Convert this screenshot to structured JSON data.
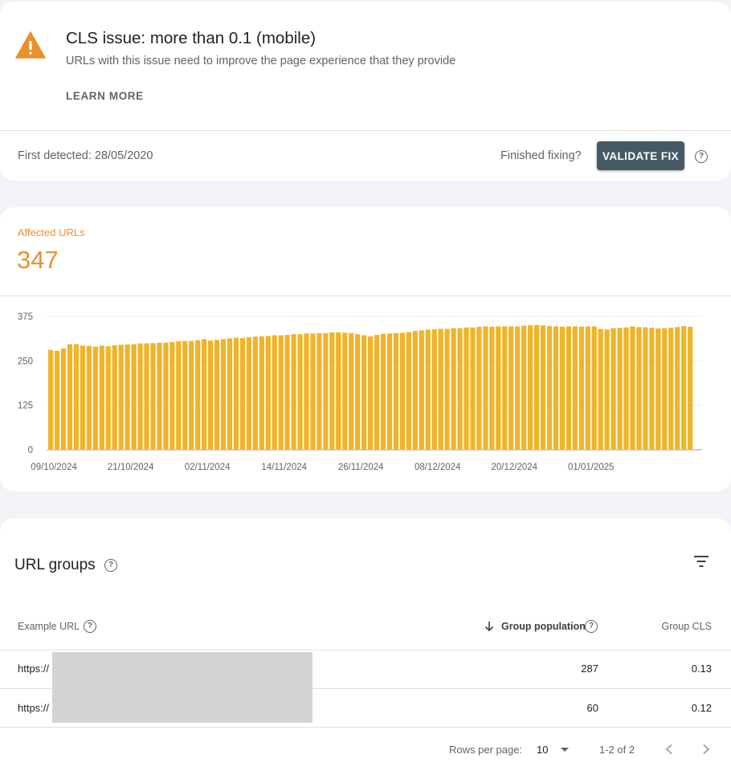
{
  "issue": {
    "title": "CLS issue: more than 0.1 (mobile)",
    "subtitle": "URLs with this issue need to improve the page experience that they provide",
    "learn_more": "LEARN MORE",
    "first_detected": "First detected: 28/05/2020",
    "finished_fixing": "Finished fixing?",
    "validate_fix": "VALIDATE FIX",
    "icon": "warning-triangle-icon",
    "accent_color": "#e8912d"
  },
  "affected": {
    "label": "Affected URLs",
    "count": "347"
  },
  "chart_data": {
    "type": "bar",
    "y_tick_labels": [
      "375",
      "250",
      "125",
      "0"
    ],
    "x_tick_labels": [
      "09/10/2024",
      "21/10/2024",
      "02/11/2024",
      "14/11/2024",
      "26/11/2024",
      "08/12/2024",
      "20/12/2024",
      "01/01/2025"
    ],
    "ylim": [
      0,
      375
    ],
    "grid": true,
    "bar_color": "#f0b429",
    "values": [
      281,
      278,
      285,
      297,
      297,
      293,
      292,
      290,
      293,
      291,
      294,
      295,
      296,
      297,
      299,
      299,
      300,
      301,
      301,
      303,
      305,
      306,
      306,
      308,
      311,
      307,
      309,
      311,
      313,
      315,
      314,
      316,
      318,
      319,
      320,
      322,
      322,
      323,
      325,
      325,
      327,
      327,
      328,
      328,
      330,
      330,
      329,
      328,
      325,
      322,
      319,
      323,
      326,
      327,
      328,
      329,
      331,
      334,
      336,
      338,
      339,
      340,
      340,
      342,
      342,
      344,
      344,
      346,
      347,
      346,
      347,
      347,
      347,
      347,
      349,
      350,
      351,
      350,
      348,
      347,
      346,
      347,
      347,
      346,
      347,
      347,
      340,
      338,
      342,
      343,
      344,
      347,
      345,
      344,
      343,
      341,
      342,
      343,
      345,
      348,
      346
    ]
  },
  "groups": {
    "title": "URL groups",
    "col_url": "Example URL",
    "col_population": "Group population",
    "col_cls": "Group CLS",
    "rows": [
      {
        "url": "https://",
        "population": "287",
        "cls": "0.13"
      },
      {
        "url": "https://",
        "population": "60",
        "cls": "0.12"
      }
    ],
    "rows_per_page_label": "Rows per page:",
    "rows_per_page_value": "10",
    "range": "1-2 of 2"
  }
}
